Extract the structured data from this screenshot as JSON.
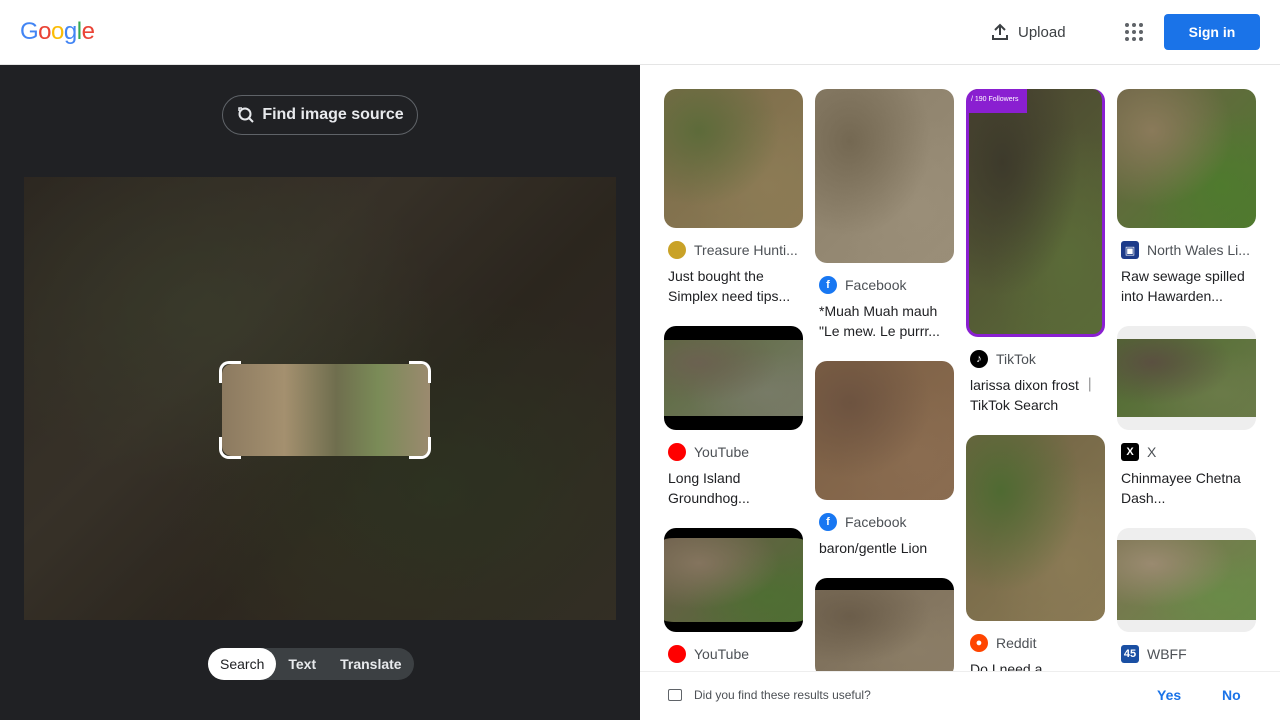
{
  "header": {
    "logo": [
      "G",
      "o",
      "o",
      "g",
      "l",
      "e"
    ],
    "logo_colors": [
      "#4285f4",
      "#ea4335",
      "#fbbc05",
      "#4285f4",
      "#34a853",
      "#ea4335"
    ],
    "upload_label": "Upload",
    "signin_label": "Sign in"
  },
  "left": {
    "find_source_label": "Find image source",
    "tabs": [
      "Search",
      "Text",
      "Translate"
    ],
    "active_tab": "Search"
  },
  "results": {
    "col1": [
      {
        "source": "Treasure Hunti...",
        "favicon": "treasure-icon",
        "fav_color": "#c9a227",
        "caption": "Just bought the Simplex need tips...",
        "thumb": [
          "#7a6a48",
          "#8c7b55",
          "#5d6b3a"
        ]
      },
      {
        "source": "YouTube",
        "favicon": "youtube-icon",
        "fav_color": "#ff0000",
        "caption": "Long Island Groundhog...",
        "thumb": [
          "#5b6a3e",
          "#777a66",
          "#6b6150"
        ]
      },
      {
        "source": "YouTube",
        "favicon": "youtube-icon",
        "fav_color": "#ff0000",
        "caption": "",
        "thumb": [
          "#6b5c4a",
          "#4f6e33",
          "#84745e"
        ]
      }
    ],
    "col2": [
      {
        "source": "Facebook",
        "favicon": "facebook-icon",
        "fav_color": "#1877f2",
        "caption": "*Muah Muah mauh \"Le mew. Le purrr...",
        "thumb": [
          "#8b7f69",
          "#9a8e78",
          "#746852"
        ]
      },
      {
        "source": "Facebook",
        "favicon": "facebook-icon",
        "fav_color": "#1877f2",
        "caption": "baron/gentle Lion",
        "thumb": [
          "#7c5f44",
          "#8a6c50",
          "#6d5340"
        ]
      },
      {
        "source": "",
        "favicon": "",
        "fav_color": "",
        "caption": "",
        "thumb": [
          "#7a6c58",
          "#8b7d66",
          "#6b5d4a"
        ]
      }
    ],
    "col3": [
      {
        "source": "TikTok",
        "favicon": "tiktok-icon",
        "fav_color": "#000000",
        "caption": "larissa dixon frost ｜TikTok Search",
        "thumb": [
          "#4a4330",
          "#5b6b38",
          "#3d3a2b"
        ],
        "tag": "/ 190 Followers"
      },
      {
        "source": "Reddit",
        "favicon": "reddit-icon",
        "fav_color": "#ff4500",
        "caption": "Do I need a",
        "thumb": [
          "#6f6242",
          "#8a7a55",
          "#4f6a32"
        ]
      }
    ],
    "col4": [
      {
        "source": "North Wales Li...",
        "favicon": "northwales-icon",
        "fav_color": "#1d3b8a",
        "caption": "Raw sewage spilled into Hawarden...",
        "thumb": [
          "#6b6245",
          "#4f7a2e",
          "#8a7a5a"
        ]
      },
      {
        "source": "X",
        "favicon": "x-icon",
        "fav_color": "#000000",
        "caption": "Chinmayee Chetna Dash...",
        "thumb": [
          "#4f6a30",
          "#6a7a48",
          "#5a5040"
        ]
      },
      {
        "source": "WBFF",
        "favicon": "wbff-icon",
        "fav_color": "#1a4fa3",
        "caption": "",
        "thumb": [
          "#7a7250",
          "#6a8a48",
          "#9a8a70"
        ]
      }
    ]
  },
  "feedback": {
    "question": "Did you find these results useful?",
    "yes": "Yes",
    "no": "No"
  }
}
